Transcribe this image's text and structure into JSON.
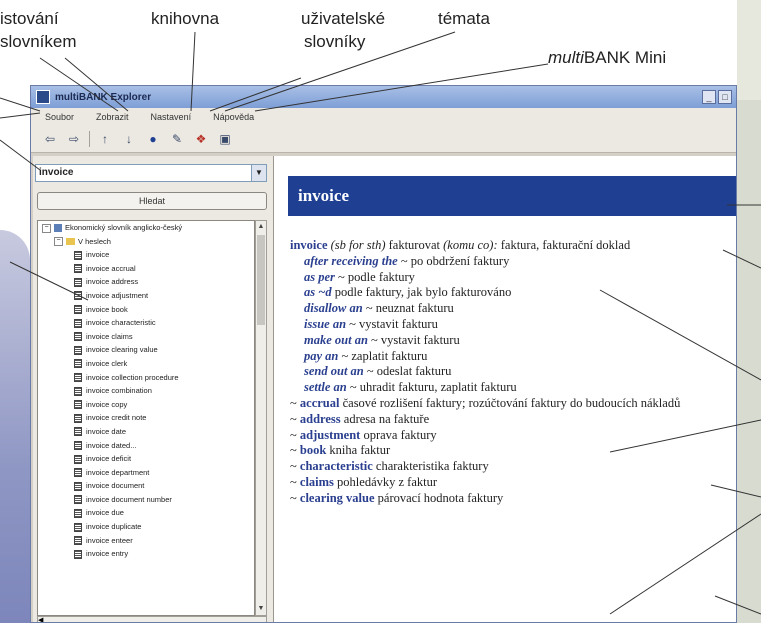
{
  "annotations": {
    "listovani": "istování",
    "slovnikem": "slovníkem",
    "knihovna": "knihovna",
    "uzivatelske": "uživatelské",
    "slovniky": "slovníky",
    "temata": "témata",
    "multibank_italic": "multi",
    "multibank_rest": "BANK Mini"
  },
  "window": {
    "title": "multiBANK Explorer",
    "controls": [
      "_",
      "□"
    ]
  },
  "menu": [
    "Soubor",
    "Zobrazit",
    "Nastavení",
    "Nápověda"
  ],
  "toolbar_icons": [
    "back-icon",
    "forward-icon",
    "browse-prev-icon",
    "browse-next-icon",
    "library-icon",
    "user-dictionary-icon",
    "topics-icon",
    "multibank-mini-icon"
  ],
  "search": {
    "value": "invoice",
    "button": "Hledat"
  },
  "tree": {
    "root": "Ekonomický slovník anglicko-český",
    "folder": "V heslech",
    "items": [
      "invoice",
      "invoice accrual",
      "invoice address",
      "invoice adjustment",
      "invoice book",
      "invoice characteristic",
      "invoice claims",
      "invoice clearing value",
      "invoice clerk",
      "invoice collection procedure",
      "invoice combination",
      "invoice copy",
      "invoice credit note",
      "invoice date",
      "invoice dated...",
      "invoice deficit",
      "invoice department",
      "invoice document",
      "invoice document number",
      "invoice due",
      "invoice duplicate",
      "invoice enteer",
      "invoice entry"
    ]
  },
  "entry": {
    "title": "invoice",
    "main": {
      "hw": "invoice",
      "gram": "(sb for sth)",
      "verb": "fakturovat",
      "target": "(komu co):",
      "def": "faktura, fakturační doklad"
    },
    "phrases": [
      {
        "p": "after receiving the",
        "rest": "~ po obdržení faktury"
      },
      {
        "p": "as per",
        "rest": "~ podle faktury"
      },
      {
        "p": "as ~d",
        "rest": "podle faktury, jak bylo fakturováno"
      },
      {
        "p": "disallow an",
        "rest": "~ neuznat fakturu"
      },
      {
        "p": "issue an",
        "rest": "~ vystavit fakturu"
      },
      {
        "p": "make out an",
        "rest": "~ vystavit fakturu"
      },
      {
        "p": "pay an",
        "rest": "~ zaplatit fakturu"
      },
      {
        "p": "send out an",
        "rest": "~ odeslat fakturu"
      },
      {
        "p": "settle an",
        "rest": "~ uhradit fakturu, zaplatit fakturu"
      }
    ],
    "compounds": [
      {
        "w": "accrual",
        "d": "časové rozlišení faktury; rozúčtování faktury do budoucích nákladů"
      },
      {
        "w": "address",
        "d": "adresa na faktuře"
      },
      {
        "w": "adjustment",
        "d": "oprava faktury"
      },
      {
        "w": "book",
        "d": "kniha faktur"
      },
      {
        "w": "characteristic",
        "d": "charakteristika faktury"
      },
      {
        "w": "claims",
        "d": "pohledávky z faktur"
      },
      {
        "w": "clearing value",
        "d": "párovací hodnota faktury"
      }
    ]
  },
  "colors": {
    "header_bg": "#1f3f93",
    "headword": "#2a3f8f"
  }
}
